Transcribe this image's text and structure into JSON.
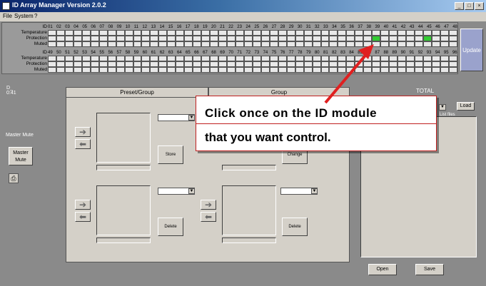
{
  "window": {
    "title": "ID Array Manager Version 2.0.2",
    "controls": {
      "minimize": "_",
      "maximize": "□",
      "close": "×"
    }
  },
  "menu": {
    "items": [
      "File",
      "System",
      "?"
    ]
  },
  "grid": {
    "row1": {
      "id_label": "ID",
      "temperature_label": "Temperature",
      "protection_label": "Protection",
      "muted_label": "Muted",
      "ids": [
        "01",
        "02",
        "03",
        "04",
        "05",
        "06",
        "07",
        "08",
        "09",
        "10",
        "11",
        "12",
        "13",
        "14",
        "15",
        "16",
        "17",
        "18",
        "19",
        "20",
        "21",
        "22",
        "23",
        "24",
        "25",
        "26",
        "27",
        "28",
        "29",
        "30",
        "31",
        "32",
        "33",
        "34",
        "35",
        "36",
        "37",
        "38",
        "39",
        "40",
        "41",
        "42",
        "43",
        "44",
        "45",
        "46",
        "47",
        "48"
      ],
      "active_index": [
        38,
        44
      ]
    },
    "row2": {
      "id_label": "ID",
      "temperature_label": "Temperature",
      "protection_label": "Protection",
      "muted_label": "Muted",
      "ids": [
        "49",
        "50",
        "51",
        "52",
        "53",
        "54",
        "55",
        "56",
        "57",
        "58",
        "59",
        "60",
        "61",
        "62",
        "63",
        "64",
        "65",
        "66",
        "67",
        "68",
        "69",
        "70",
        "71",
        "72",
        "73",
        "74",
        "75",
        "76",
        "77",
        "78",
        "79",
        "80",
        "81",
        "82",
        "83",
        "84",
        "85",
        "86",
        "87",
        "88",
        "89",
        "90",
        "91",
        "92",
        "93",
        "94",
        "95",
        "96"
      ]
    },
    "update_label": "Update"
  },
  "left_panel": {
    "clock_text": "D_\n0:41",
    "master_mute_label": "Master Mute",
    "master_mute_button": "Master\nMute"
  },
  "tabs": {
    "preset_group": "Preset/Group",
    "group": "Group"
  },
  "buttons": {
    "store": "Store",
    "change": "Change",
    "delete": "Delete",
    "delete2": "Delete",
    "open": "Open",
    "save": "Save"
  },
  "right_panel": {
    "label": "TOTAL",
    "button": "Load",
    "list_label": "List files"
  },
  "callout": {
    "line1": "Click once on the ID module",
    "line2": "that you want control."
  },
  "colors": {
    "title_start": "#0a246a",
    "title_end": "#a6caf0",
    "active_cell": "#33cc33",
    "callout_border": "#c02020",
    "arrow": "#e02020"
  }
}
